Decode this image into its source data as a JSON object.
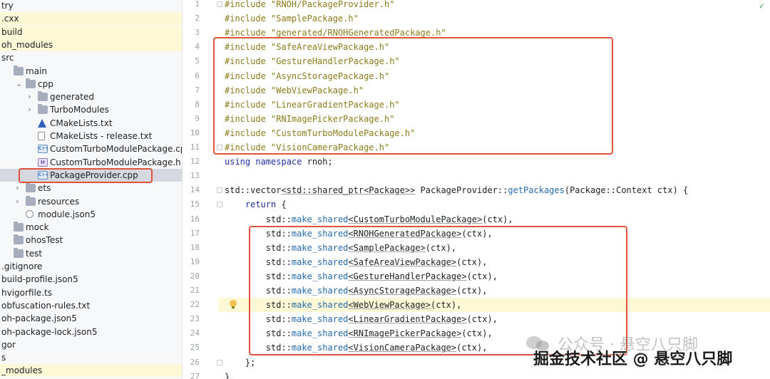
{
  "sidebar": {
    "rows": [
      {
        "label": "try",
        "kind": "none",
        "depth": 0
      },
      {
        "label": ".cxx",
        "kind": "none",
        "depth": 0
      },
      {
        "label": "build",
        "kind": "none",
        "depth": 0
      },
      {
        "label": "oh_modules",
        "kind": "none",
        "depth": 0
      },
      {
        "label": "src",
        "kind": "none",
        "depth": 0
      },
      {
        "label": "main",
        "kind": "folder",
        "depth": 1
      },
      {
        "label": "cpp",
        "kind": "folder",
        "depth": 2,
        "chevron": "down"
      },
      {
        "label": "generated",
        "kind": "folder",
        "depth": 3,
        "chevron": "right"
      },
      {
        "label": "TurboModules",
        "kind": "folder",
        "depth": 3,
        "chevron": "right"
      },
      {
        "label": "CMakeLists.txt",
        "kind": "cmake",
        "depth": 3
      },
      {
        "label": "CMakeLists - release.txt",
        "kind": "txt",
        "depth": 3
      },
      {
        "label": "CustomTurboModulePackage.cpp",
        "kind": "cpp",
        "depth": 3
      },
      {
        "label": "CustomTurboModulePackage.h",
        "kind": "h",
        "depth": 3
      },
      {
        "label": "PackageProvider.cpp",
        "kind": "cpp",
        "depth": 3,
        "selected": true
      },
      {
        "label": "ets",
        "kind": "folder",
        "depth": 2,
        "chevron": "right"
      },
      {
        "label": "resources",
        "kind": "folder",
        "depth": 2,
        "chevron": "right"
      },
      {
        "label": "module.json5",
        "kind": "json",
        "depth": 2
      },
      {
        "label": "mock",
        "kind": "folder",
        "depth": 1
      },
      {
        "label": "ohosTest",
        "kind": "folder",
        "depth": 1
      },
      {
        "label": "test",
        "kind": "folder",
        "depth": 1
      },
      {
        "label": ".gitignore",
        "kind": "none",
        "depth": 0
      },
      {
        "label": "build-profile.json5",
        "kind": "none",
        "depth": 0
      },
      {
        "label": "hvigorfile.ts",
        "kind": "none",
        "depth": 0
      },
      {
        "label": "obfuscation-rules.txt",
        "kind": "none",
        "depth": 0
      },
      {
        "label": "oh-package.json5",
        "kind": "none",
        "depth": 0
      },
      {
        "label": "oh-package-lock.json5",
        "kind": "none",
        "depth": 0
      },
      {
        "label": "gor",
        "kind": "none",
        "depth": 0
      },
      {
        "label": "s",
        "kind": "none",
        "depth": 0
      },
      {
        "label": "_modules",
        "kind": "none",
        "depth": 0
      }
    ]
  },
  "editor": {
    "lines": [
      {
        "n": "1",
        "segs": [
          [
            "pp",
            "#include \"RNOH/PackageProvider.h\""
          ]
        ]
      },
      {
        "n": "2",
        "segs": [
          [
            "pp",
            "#include \"SamplePackage.h\""
          ]
        ]
      },
      {
        "n": "3",
        "segs": [
          [
            "pp",
            "#include \"generated/RNOHGeneratedPackage.h\""
          ]
        ]
      },
      {
        "n": "4",
        "segs": [
          [
            "pp",
            "#include \"SafeAreaViewPackage.h\""
          ]
        ]
      },
      {
        "n": "5",
        "segs": [
          [
            "pp",
            "#include \"GestureHandlerPackage.h\""
          ]
        ]
      },
      {
        "n": "6",
        "segs": [
          [
            "pp",
            "#include \"AsyncStoragePackage.h\""
          ]
        ]
      },
      {
        "n": "7",
        "segs": [
          [
            "pp",
            "#include \"WebViewPackage.h\""
          ]
        ]
      },
      {
        "n": "8",
        "segs": [
          [
            "pp",
            "#include \"LinearGradientPackage.h\""
          ]
        ]
      },
      {
        "n": "9",
        "segs": [
          [
            "pp",
            "#include \"RNImagePickerPackage.h\""
          ]
        ]
      },
      {
        "n": "10",
        "segs": [
          [
            "pp",
            "#include \"CustomTurboModulePackage.h\""
          ]
        ]
      },
      {
        "n": "11",
        "segs": [
          [
            "pp",
            "#include \"VisionCameraPackage.h\""
          ]
        ]
      },
      {
        "n": "12",
        "segs": [
          [
            "kw",
            "using namespace"
          ],
          [
            "",
            " rnoh;"
          ]
        ]
      },
      {
        "n": "13",
        "segs": []
      },
      {
        "n": "14",
        "segs": [
          [
            "",
            "std::vector"
          ],
          [
            "tpl",
            "<std::shared_ptr<Package>>"
          ],
          [
            "",
            " PackageProvider::"
          ],
          [
            "fn",
            "getPackages"
          ],
          [
            "",
            "(Package::Context ctx) {"
          ]
        ]
      },
      {
        "n": "15",
        "segs": [
          [
            "",
            "    "
          ],
          [
            "kw",
            "return"
          ],
          [
            "",
            " {"
          ]
        ]
      },
      {
        "n": "16",
        "segs": [
          [
            "",
            "        std::"
          ],
          [
            "fn",
            "make_shared"
          ],
          [
            "tpl",
            "<CustomTurboModulePackage>"
          ],
          [
            "",
            "(ctx),"
          ]
        ]
      },
      {
        "n": "17",
        "segs": [
          [
            "",
            "        std::"
          ],
          [
            "fn",
            "make_shared"
          ],
          [
            "tpl",
            "<RNOHGeneratedPackage>"
          ],
          [
            "",
            "(ctx),"
          ]
        ]
      },
      {
        "n": "18",
        "segs": [
          [
            "",
            "        std::"
          ],
          [
            "fn",
            "make_shared"
          ],
          [
            "tpl",
            "<SamplePackage>"
          ],
          [
            "",
            "(ctx),"
          ]
        ]
      },
      {
        "n": "19",
        "segs": [
          [
            "",
            "        std::"
          ],
          [
            "fn",
            "make_shared"
          ],
          [
            "tpl",
            "<SafeAreaViewPackage>"
          ],
          [
            "",
            "(ctx),"
          ]
        ]
      },
      {
        "n": "20",
        "segs": [
          [
            "",
            "        std::"
          ],
          [
            "fn",
            "make_shared"
          ],
          [
            "tpl",
            "<GestureHandlerPackage>"
          ],
          [
            "",
            "(ctx),"
          ]
        ]
      },
      {
        "n": "21",
        "segs": [
          [
            "",
            "        std::"
          ],
          [
            "fn",
            "make_shared"
          ],
          [
            "tpl",
            "<AsyncStoragePackage>"
          ],
          [
            "",
            "(ctx),"
          ]
        ]
      },
      {
        "n": "22",
        "segs": [
          [
            "",
            "        std::"
          ],
          [
            "fn",
            "make_shared"
          ],
          [
            "tpl",
            "<WebViewPackage>"
          ],
          [
            "",
            "(ctx),"
          ]
        ],
        "hl": true
      },
      {
        "n": "23",
        "segs": [
          [
            "",
            "        std::"
          ],
          [
            "fn",
            "make_shared"
          ],
          [
            "tpl",
            "<LinearGradientPackage>"
          ],
          [
            "",
            "(ctx),"
          ]
        ]
      },
      {
        "n": "24",
        "segs": [
          [
            "",
            "        std::"
          ],
          [
            "fn",
            "make_shared"
          ],
          [
            "tpl",
            "<RNImagePickerPackage>"
          ],
          [
            "",
            "(ctx),"
          ]
        ]
      },
      {
        "n": "25",
        "segs": [
          [
            "",
            "        std::"
          ],
          [
            "fn",
            "make_shared"
          ],
          [
            "tpl",
            "<VisionCameraPackage>"
          ],
          [
            "",
            "(ctx),"
          ]
        ]
      },
      {
        "n": "26",
        "segs": [
          [
            "",
            "    };"
          ]
        ]
      },
      {
        "n": "27",
        "segs": [
          [
            "",
            "}"
          ]
        ]
      }
    ]
  },
  "watermark": {
    "line1": "公众号 · 悬空八只脚",
    "line2": "掘金技术社区 @ 悬空八只脚"
  },
  "colors": {
    "annotation": "#e0523a",
    "preprocessor": "#8a7b1b",
    "keyword": "#1f2f9c",
    "function": "#2569a8"
  }
}
